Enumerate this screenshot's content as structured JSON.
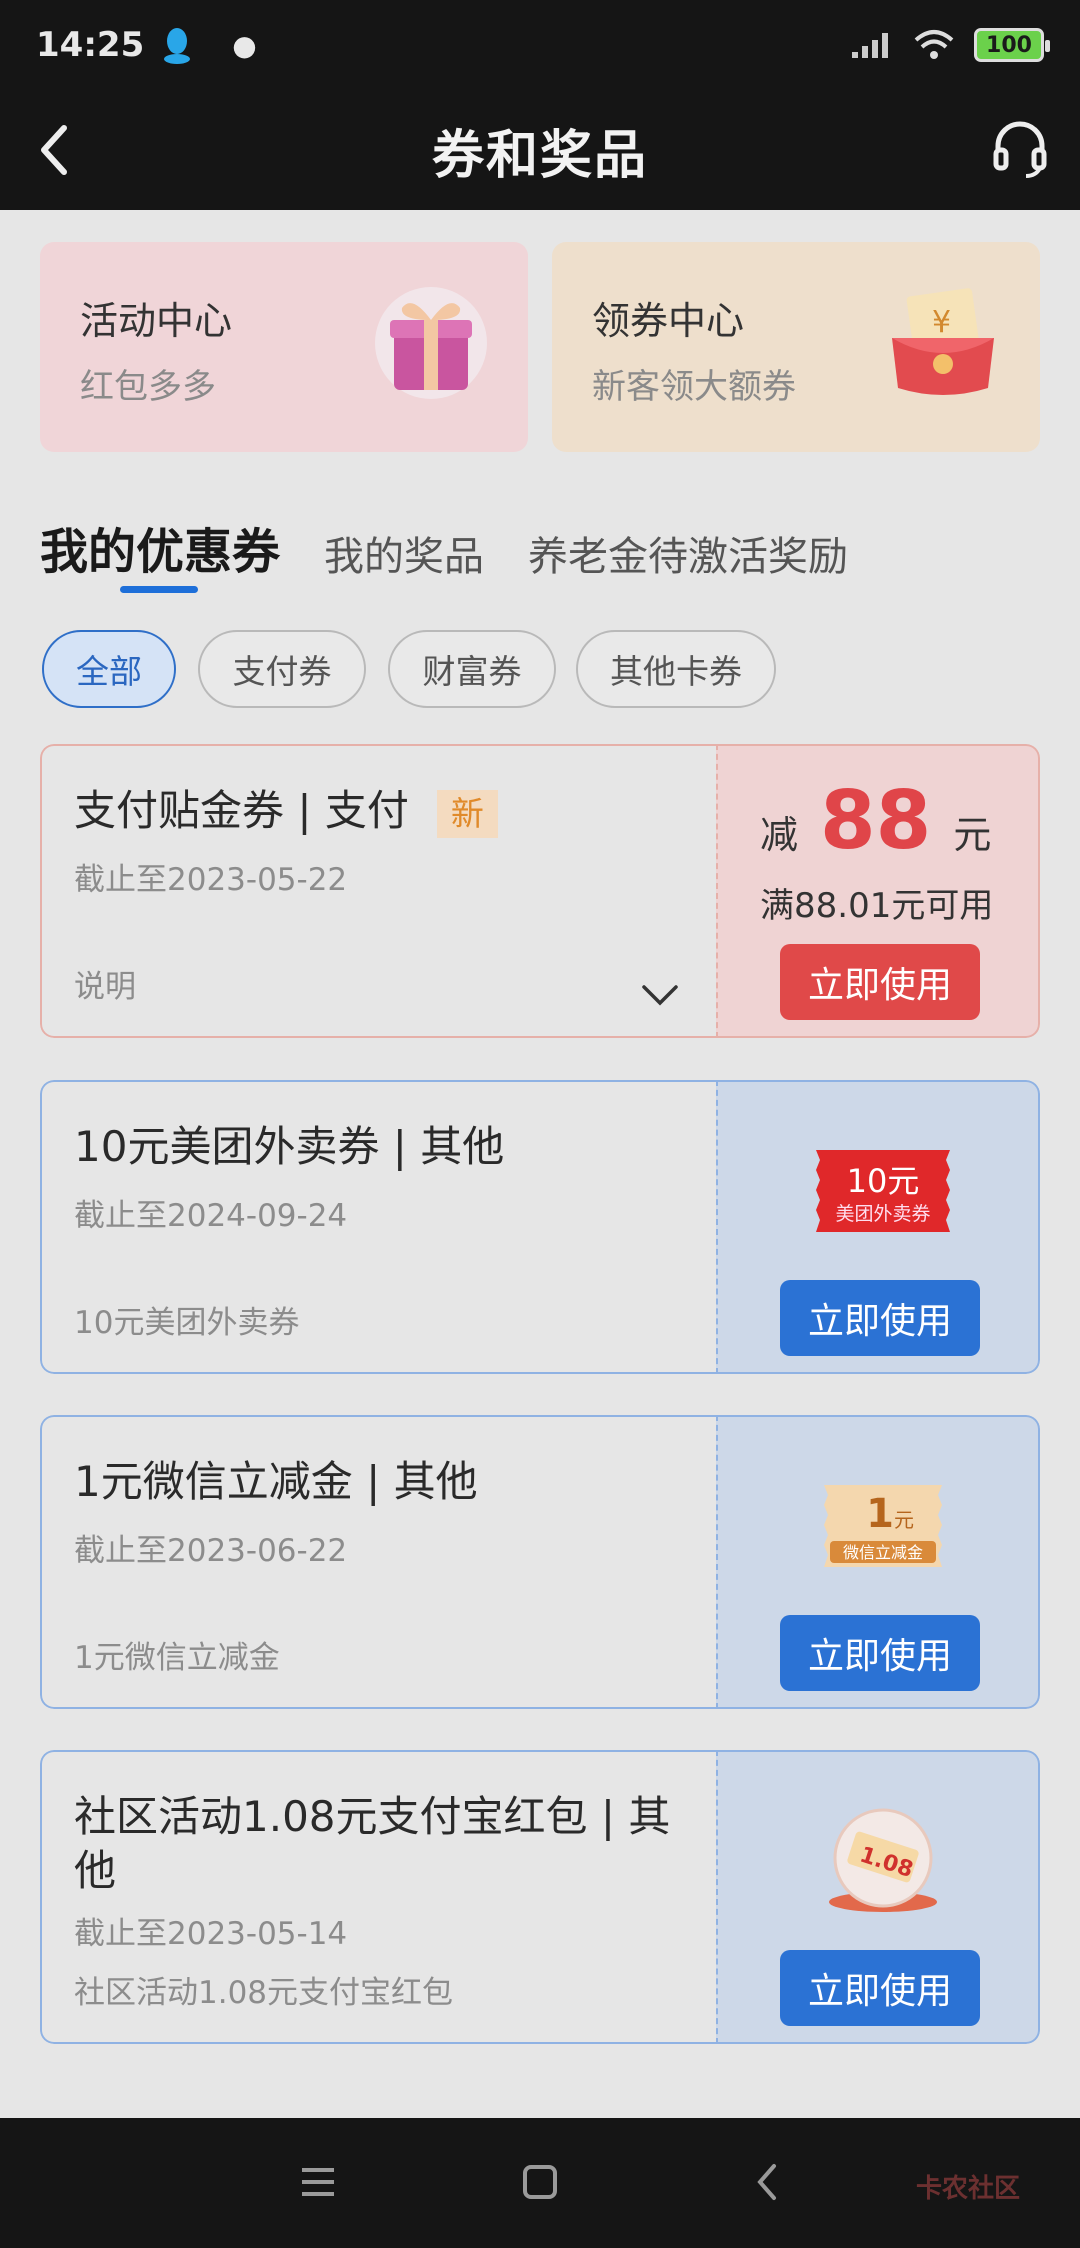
{
  "status": {
    "time": "14:25",
    "battery": "100"
  },
  "header": {
    "title": "券和奖品"
  },
  "quick_cards": [
    {
      "title": "活动中心",
      "subtitle": "红包多多"
    },
    {
      "title": "领券中心",
      "subtitle": "新客领大额券"
    }
  ],
  "tabs": [
    "我的优惠券",
    "我的奖品",
    "养老金待激活奖励"
  ],
  "filters": [
    "全部",
    "支付券",
    "财富券",
    "其他卡券"
  ],
  "coupons": [
    {
      "title": "支付贴金券 | 支付",
      "badge": "新",
      "date": "截止至2023-05-22",
      "desc": "说明",
      "amount_prefix": "减",
      "amount": "88",
      "amount_unit": "元",
      "condition": "满88.01元可用",
      "button": "立即使用"
    },
    {
      "title": "10元美团外卖券 | 其他",
      "date": "截止至2024-09-24",
      "desc": "10元美团外卖券",
      "thumb_main": "10元",
      "thumb_sub": "美团外卖券",
      "button": "立即使用"
    },
    {
      "title": "1元微信立减金 | 其他",
      "date": "截止至2023-06-22",
      "desc": "1元微信立减金",
      "thumb_main": "1",
      "thumb_unit": "元",
      "thumb_sub": "微信立减金",
      "button": "立即使用"
    },
    {
      "title": "社区活动1.08元支付宝红包 | 其他",
      "date": "截止至2023-05-14",
      "desc": "社区活动1.08元支付宝红包",
      "thumb_main": "1.08",
      "button": "立即使用"
    }
  ],
  "watermark": "卡农社区",
  "colors": {
    "accent_blue": "#2b72d4",
    "accent_red": "#e04949",
    "header_bg": "#151515"
  }
}
